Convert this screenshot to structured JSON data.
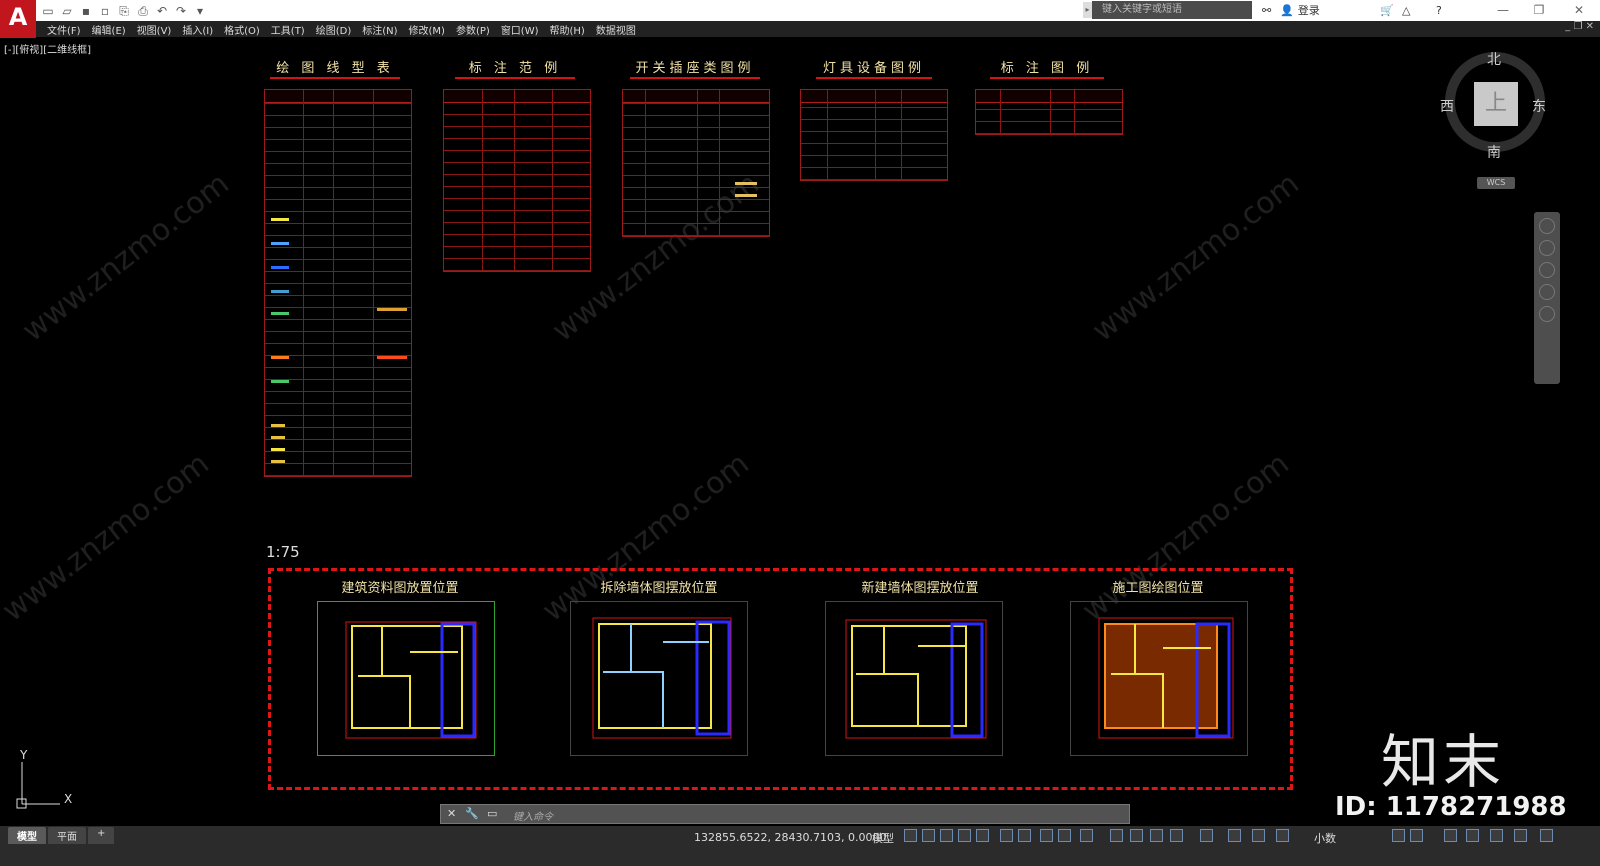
{
  "app": {
    "logo": "A"
  },
  "search": {
    "placeholder": "键入关键字或短语"
  },
  "titlebar": {
    "login": "登录"
  },
  "menu": [
    "文件(F)",
    "编辑(E)",
    "视图(V)",
    "插入(I)",
    "格式(O)",
    "工具(T)",
    "绘图(D)",
    "标注(N)",
    "修改(M)",
    "参数(P)",
    "窗口(W)",
    "帮助(H)",
    "数据视图"
  ],
  "viewport": {
    "label": "[-][俯视][二维线框]"
  },
  "sheets": {
    "t1": "绘 图 线 型 表",
    "t2": "标 注 范 例",
    "t3": "开关插座类图例",
    "t4": "灯具设备图例",
    "t5": "标 注 图 例"
  },
  "scale_label": "1:75",
  "plans": [
    {
      "caption": "建筑资料图放置位置"
    },
    {
      "caption": "拆除墙体图摆放位置"
    },
    {
      "caption": "新建墙体图摆放位置"
    },
    {
      "caption": "施工图绘图位置"
    }
  ],
  "viewcube": {
    "north": "北",
    "south": "南",
    "east": "东",
    "west": "西",
    "face": "上",
    "wcs": "WCS"
  },
  "ucs": {
    "x": "X",
    "y": "Y"
  },
  "command": {
    "placeholder": "键入命令"
  },
  "tabs": [
    "模型",
    "平面"
  ],
  "status": {
    "coords": "132855.6522, 28430.7103, 0.0000",
    "model": "模型",
    "units": "小数"
  },
  "watermark": {
    "brand": "知末",
    "id": "ID: 1178271988",
    "site": "www.znzmo.com"
  },
  "colors": {
    "accent": "#c2161e",
    "table_line": "#9c1a1a",
    "dash": "#e01515",
    "title_text": "#f2e2a6"
  }
}
